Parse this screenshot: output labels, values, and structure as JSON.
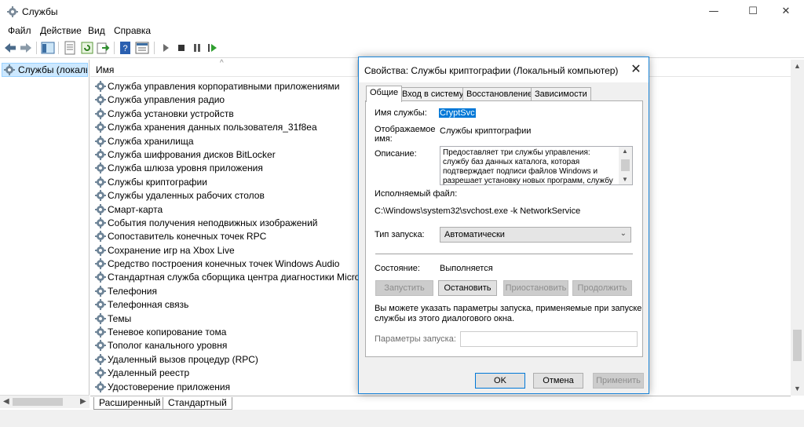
{
  "window": {
    "title": "Службы",
    "minimize": "—",
    "maximize": "☐",
    "close": "✕"
  },
  "menu": [
    "Файл",
    "Действие",
    "Вид",
    "Справка"
  ],
  "nav": {
    "item": "Службы (локальные)"
  },
  "list": {
    "column_name": "Имя",
    "sort_indicator": "^",
    "services": [
      "Служба управления корпоративными приложениями",
      "Служба управления радио",
      "Служба установки устройств",
      "Служба хранения данных пользователя_31f8ea",
      "Служба хранилища",
      "Служба шифрования дисков BitLocker",
      "Служба шлюза уровня приложения",
      "Службы криптографии",
      "Службы удаленных рабочих столов",
      "Смарт-карта",
      "События получения неподвижных изображений",
      "Сопоставитель конечных точек RPC",
      "Сохранение игр на Xbox Live",
      "Средство построения конечных точек Windows Audio",
      "Стандартная служба сборщика центра диагностики Microso...",
      "Телефония",
      "Телефонная связь",
      "Темы",
      "Теневое копирование тома",
      "Тополог канального уровня",
      "Удаленный вызов процедур (RPC)",
      "Удаленный реестр",
      "Удостоверение приложения"
    ]
  },
  "bottom_tabs": [
    "Расширенный",
    "Стандартный"
  ],
  "dialog": {
    "title": "Свойства: Службы криптографии (Локальный компьютер)",
    "close": "✕",
    "tabs": [
      "Общие",
      "Вход в систему",
      "Восстановление",
      "Зависимости"
    ],
    "service_name_label": "Имя службы:",
    "service_name_value": "CryptSvc",
    "display_name_label_1": "Отображаемое",
    "display_name_label_2": "имя:",
    "display_name_value": "Службы криптографии",
    "description_label": "Описание:",
    "description_text": "Предоставляет три службы управления: службу баз данных каталога, которая подтверждает подписи файлов Windows и разрешает установку новых программ, службу",
    "exe_label": "Исполняемый файл:",
    "exe_path": "C:\\Windows\\system32\\svchost.exe -k NetworkService",
    "startup_type_label": "Тип запуска:",
    "startup_type_value": "Автоматически",
    "status_label": "Состояние:",
    "status_value": "Выполняется",
    "btn_start": "Запустить",
    "btn_stop": "Остановить",
    "btn_pause": "Приостановить",
    "btn_resume": "Продолжить",
    "hint_line1": "Вы можете указать параметры запуска, применяемые при запуске",
    "hint_line2": "службы из этого диалогового окна.",
    "params_label": "Параметры запуска:",
    "params_value": "",
    "btn_ok": "OK",
    "btn_cancel": "Отмена",
    "btn_apply": "Применить"
  },
  "colors": {
    "selection": "#cce8ff",
    "accent": "#0078d7",
    "dialog_bg": "#f0f0f0"
  },
  "icons": [
    "gear-icon",
    "back-arrow-icon",
    "forward-arrow-icon",
    "console-tree-icon",
    "properties-icon",
    "refresh-icon",
    "export-icon",
    "help-icon",
    "view-icon",
    "play-icon",
    "stop-icon",
    "pause-icon",
    "restart-icon"
  ]
}
